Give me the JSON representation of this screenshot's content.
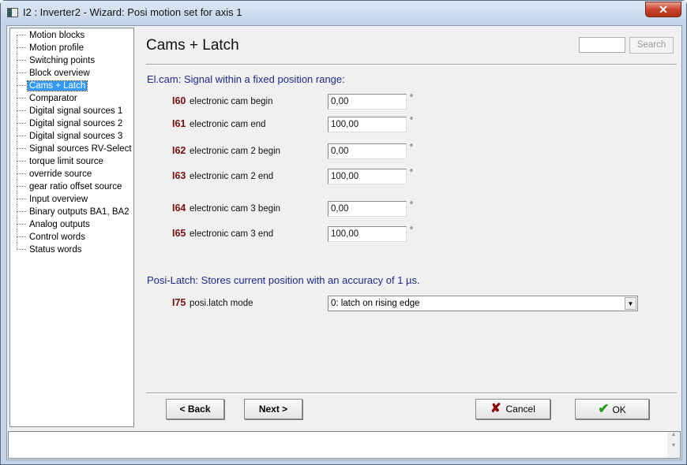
{
  "window": {
    "title": "I2 : Inverter2 - Wizard: Posi motion set for axis 1",
    "close": "✕"
  },
  "tree": {
    "selected": 4,
    "items": [
      "Motion blocks",
      "Motion profile",
      "Switching points",
      "Block overview",
      "Cams + Latch",
      "Comparator",
      "Digital signal sources 1",
      "Digital signal sources 2",
      "Digital signal sources 3",
      "Signal sources RV-Select",
      "torque limit source",
      "override source",
      "gear ratio offset source",
      "Input overview",
      "Binary outputs BA1, BA2",
      "Analog outputs",
      "Control words",
      "Status words"
    ]
  },
  "page": {
    "title": "Cams + Latch",
    "search_value": "",
    "search_label": "Search"
  },
  "elcam": {
    "heading": "El.cam: Signal within a fixed position range:",
    "unit": "°",
    "params": [
      {
        "id": "I60",
        "label": "electronic cam begin",
        "value": "0,00"
      },
      {
        "id": "I61",
        "label": "electronic cam end",
        "value": "100,00"
      },
      {
        "id": "I62",
        "label": "electronic cam 2 begin",
        "value": "0,00"
      },
      {
        "id": "I63",
        "label": "electronic cam 2 end",
        "value": "100,00"
      },
      {
        "id": "I64",
        "label": "electronic cam 3 begin",
        "value": "0,00"
      },
      {
        "id": "I65",
        "label": "electronic cam 3 end",
        "value": "100,00"
      }
    ]
  },
  "latch": {
    "heading": "Posi-Latch: Stores current position with an accuracy of 1 µs.",
    "id": "I75",
    "label": "posi.latch mode",
    "value": "0: latch on rising edge"
  },
  "buttons": {
    "back": "< Back",
    "next": "Next >",
    "cancel": "Cancel",
    "ok": "OK"
  },
  "colors": {
    "accent": "#1f2a8c",
    "param_id": "#7a1010",
    "selection": "#3399ff"
  }
}
